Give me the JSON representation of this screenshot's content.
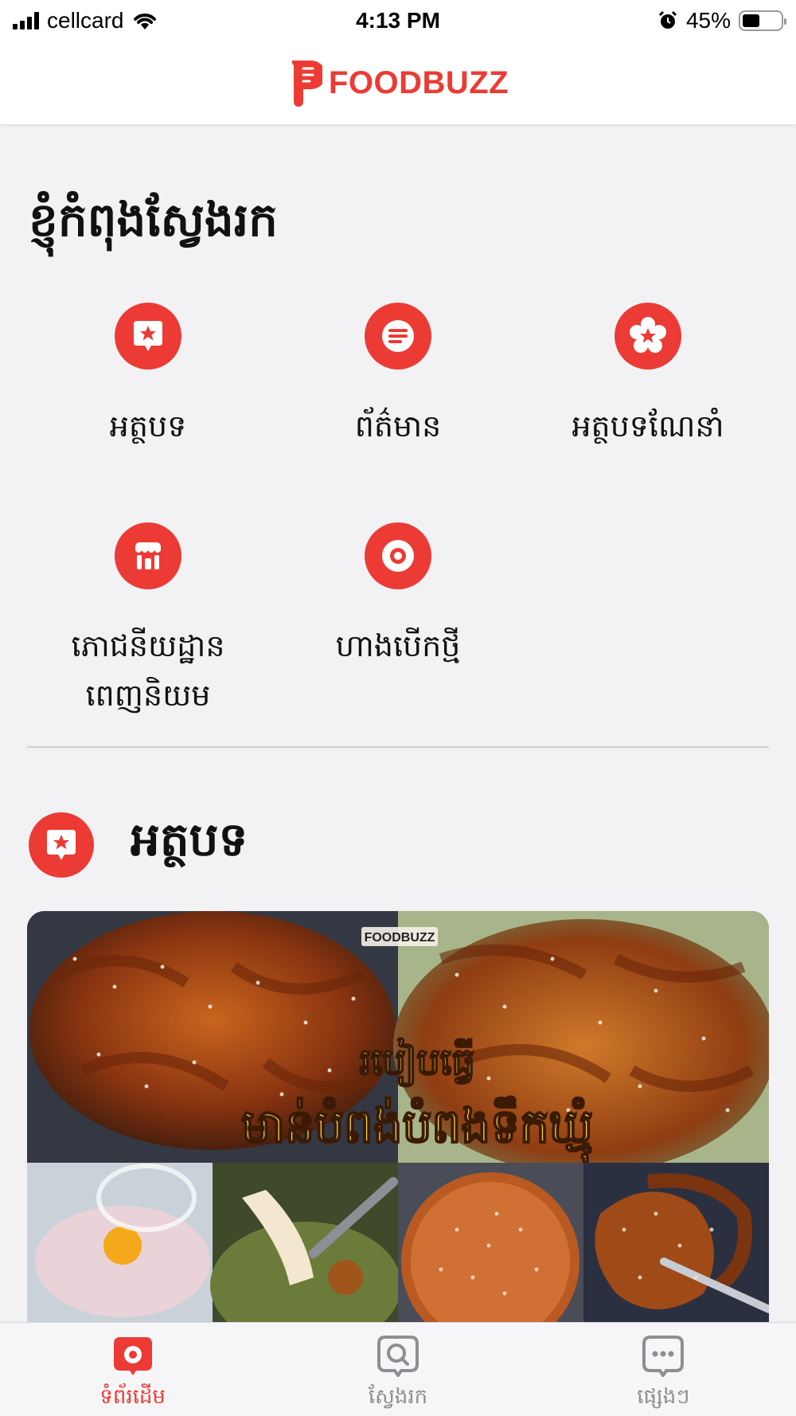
{
  "status": {
    "carrier": "cellcard",
    "time": "4:13 PM",
    "battery": "45%",
    "battery_level": 0.45
  },
  "header": {
    "brand": "FOODBUZZ",
    "brand_color": "#ec3b34"
  },
  "explore": {
    "title": "ខ្ញុំកំពុងស្វែងរក",
    "categories": [
      {
        "label": "អត្ថបទ",
        "icon": "star-badge-icon"
      },
      {
        "label": "ព័ត៌មាន",
        "icon": "news-lines-icon"
      },
      {
        "label": "អត្ថបទណែនាំ",
        "icon": "star-flower-icon"
      },
      {
        "label": "ភោជនីយដ្ឋាន\nពេញនិយម",
        "icon": "storefront-icon"
      },
      {
        "label": "ហាងបើកថ្មី",
        "icon": "ring-icon"
      }
    ]
  },
  "featured": {
    "title": "អត្ថបទ",
    "icon": "star-badge-icon",
    "card": {
      "watermark": "FOODBUZZ",
      "headline_line1": "របៀបធ្វើ",
      "headline_line2": "មាន់បំពង់បំពងទឹកឃ្មុំ"
    }
  },
  "tabbar": {
    "items": [
      {
        "label": "ទំព័រដើម",
        "icon": "home-ring-icon",
        "active": true
      },
      {
        "label": "ស្វែងរក",
        "icon": "search-bubble-icon",
        "active": false
      },
      {
        "label": "ផ្សេងៗ",
        "icon": "more-bubble-icon",
        "active": false
      }
    ]
  }
}
